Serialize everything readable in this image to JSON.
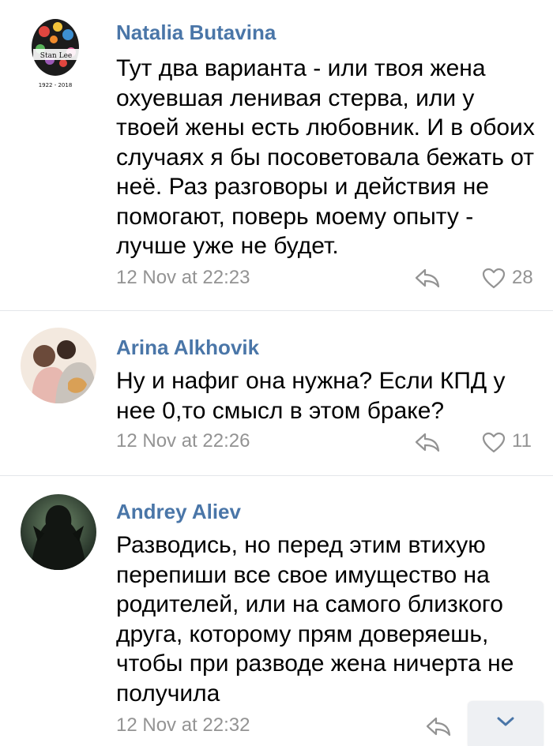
{
  "comments": [
    {
      "author": "Natalia Butavina",
      "text": "Тут два варианта - или твоя жена охуевшая ленивая стерва, или у твоей жены есть любовник. И в обоих случаях я бы посоветовала бежать от неё. Раз разговоры и действия не помогают, поверь моему опыту - лучше уже не будет.",
      "date": "12 Nov at 22:23",
      "likes": "28",
      "avatar_text_top": "Stan Lee",
      "avatar_text_bottom": "1922 - 2018"
    },
    {
      "author": "Arina Alkhovik",
      "text": "Ну и нафиг она нужна? Если КПД у нее 0,то смысл в этом браке?",
      "date": "12 Nov at 22:26",
      "likes": "11"
    },
    {
      "author": "Andrey Aliev",
      "text": "Разводись, но перед этим втихую перепиши все свое имущество на родителей, или на самого близкого друга, которому прям доверяешь, чтобы при разводе жена ничерта не получила",
      "date": "12 Nov at 22:32"
    }
  ],
  "colors": {
    "author": "#4a76a8",
    "meta": "#939393",
    "divider": "#e3e6ea",
    "scroll_button_bg": "#eef0f3"
  },
  "icons": {
    "reply": "reply-arrow-icon",
    "like": "heart-outline-icon",
    "scroll": "chevron-down-icon"
  }
}
